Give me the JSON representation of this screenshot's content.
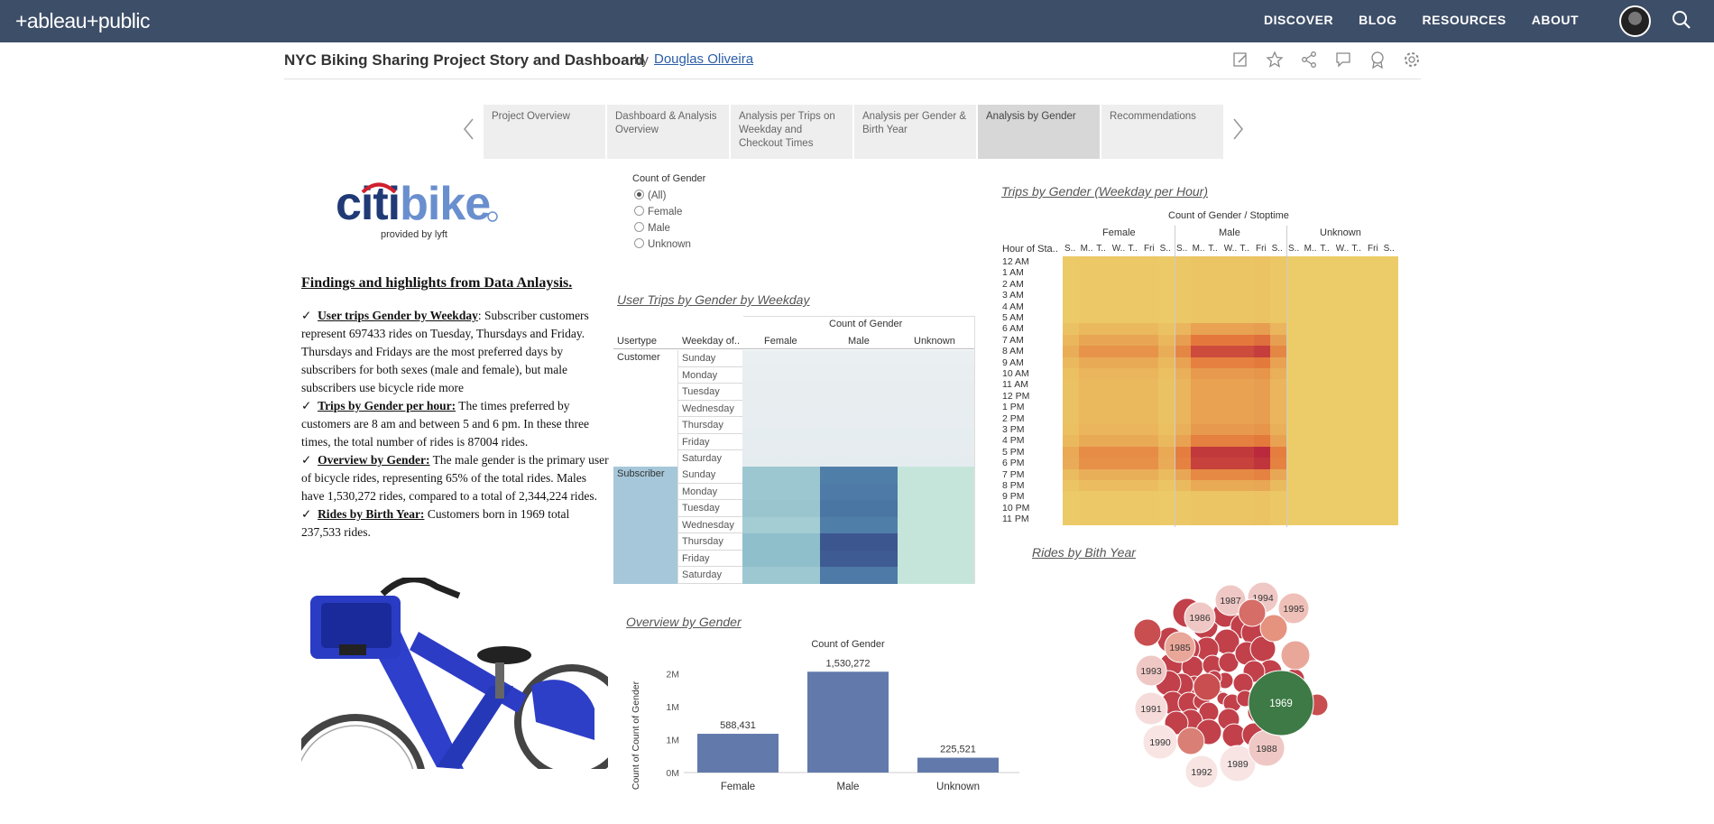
{
  "nav": {
    "logo": "+ableau+public",
    "links": [
      "DISCOVER",
      "BLOG",
      "RESOURCES",
      "ABOUT"
    ]
  },
  "viz": {
    "title": "NYC Biking Sharing Project Story and Dashboard",
    "by": "by",
    "author": "Douglas Oliveira"
  },
  "story_points": [
    "Project Overview",
    "Dashboard & Analysis Overview",
    "Analysis per Trips on Weekday and Checkout Times",
    "Analysis per Gender & Birth Year",
    "Analysis by Gender",
    "Recommendations"
  ],
  "active_story": 4,
  "brand": {
    "name_a": "citi",
    "name_b": "bike",
    "provided": "provided by lyft"
  },
  "findings": {
    "heading": "Findings and highlights from Data Anlaysis.",
    "items": [
      {
        "title": "User trips Gender by Weekday",
        "text": ": Subscriber customers represent 697433 rides on Tuesday, Thursdays and Friday. Thursdays and Fridays are the most preferred days by subscribers for both sexes (male and female), but male subscribers use bicycle ride more"
      },
      {
        "title": "Trips by Gender per hour:",
        "text": " The times preferred by customers are 8 am and between 5 and 6 pm. In these three times, the total number of rides is 87004 rides."
      },
      {
        "title": "Overview by Gender:",
        "text": " The male gender is the primary user of bicycle rides, representing 65% of the total rides. Males have 1,530,272 rides, compared to a total of 2,344,224 rides."
      },
      {
        "title": "Rides by Birth Year:",
        "text": " Customers born in 1969 total 237,533 rides."
      }
    ]
  },
  "filter": {
    "title": "Count of Gender",
    "options": [
      "(All)",
      "Female",
      "Male",
      "Unknown"
    ],
    "selected": "(All)"
  },
  "weekday_table": {
    "title": "User Trips by Gender by Weekday",
    "measure": "Count of Gender",
    "col_headers": [
      "Usertype",
      "Weekday of..",
      "Female",
      "Male",
      "Unknown"
    ],
    "usertypes": [
      "Customer",
      "Subscriber"
    ],
    "weekdays": [
      "Sunday",
      "Monday",
      "Tuesday",
      "Wednesday",
      "Thursday",
      "Friday",
      "Saturday"
    ],
    "subscriber_colors": {
      "female": [
        "#9cc7d0",
        "#9cc7d0",
        "#9ac5cf",
        "#a3ccd3",
        "#8fbfcb",
        "#8fbfcb",
        "#9dc8d1"
      ],
      "male": [
        "#4f7fa8",
        "#4d7aa6",
        "#4a76a3",
        "#4f7fa8",
        "#3c5690",
        "#3f5b93",
        "#4d7aa6"
      ],
      "unknown": [
        "#c6e5da",
        "#c6e5da",
        "#c6e5da",
        "#c6e5da",
        "#c6e5da",
        "#c6e5da",
        "#c6e5da"
      ]
    }
  },
  "heatmap": {
    "title": "Trips by Gender (Weekday per Hour)",
    "measure": "Count of Gender / Stoptime",
    "row_header": "Hour of Sta..",
    "genders": [
      "Female",
      "Male",
      "Unknown"
    ],
    "day_labels": [
      "S..",
      "M..",
      "T..",
      "W..",
      "T..",
      "Fri",
      "S.."
    ],
    "hours": [
      "12 AM",
      "1 AM",
      "2 AM",
      "3 AM",
      "4 AM",
      "5 AM",
      "6 AM",
      "7 AM",
      "8 AM",
      "9 AM",
      "10 AM",
      "11 AM",
      "12 PM",
      "1 PM",
      "2 PM",
      "3 PM",
      "4 PM",
      "5 PM",
      "6 PM",
      "7 PM",
      "8 PM",
      "9 PM",
      "10 PM",
      "11 PM"
    ]
  },
  "gender_bar": {
    "title": "Overview by Gender",
    "chart_data": {
      "type": "bar",
      "title": "Count of Gender",
      "ylabel": "Count of Count of Gender",
      "categories": [
        "Female",
        "Male",
        "Unknown"
      ],
      "values": [
        588431,
        1530272,
        225521
      ],
      "value_labels": [
        "588,431",
        "1,530,272",
        "225,521"
      ],
      "yticks": [
        "0M",
        "1M",
        "1M",
        "2M"
      ],
      "ylim": [
        0,
        1700000
      ],
      "color": "#6279ab"
    }
  },
  "birth_year": {
    "title": "Rides by Bith Year",
    "labels": [
      "1969",
      "1987",
      "1994",
      "1995",
      "1986",
      "1985",
      "1993",
      "1991",
      "1990",
      "1992",
      "1989",
      "1988"
    ],
    "highlight_color": "#3d7a45"
  }
}
